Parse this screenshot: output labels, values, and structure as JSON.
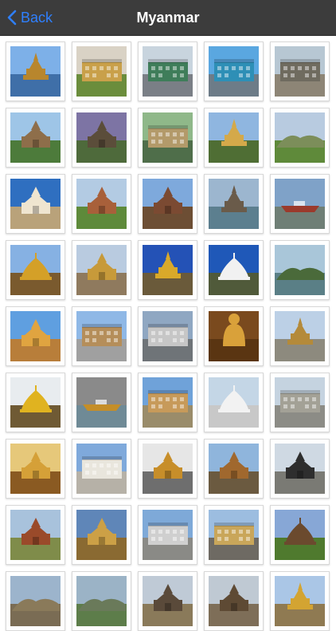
{
  "navbar": {
    "back_label": "Back",
    "title": "Myanmar"
  },
  "colors": {
    "navbar_bg": "#3c3c3c",
    "accent": "#2f80ff",
    "title_text": "#ffffff"
  },
  "gallery": {
    "tiles": [
      {
        "sky": "#7db0e8",
        "ground": "#3f6fa8",
        "subject": "#b8862d",
        "shape": "pagoda"
      },
      {
        "sky": "#d9d2c5",
        "ground": "#6b8d3c",
        "subject": "#c9a04a",
        "shape": "building"
      },
      {
        "sky": "#c8d4de",
        "ground": "#7a7f86",
        "subject": "#3f7d5a",
        "shape": "building"
      },
      {
        "sky": "#5aa7e0",
        "ground": "#6d7c88",
        "subject": "#2e8fb6",
        "shape": "building"
      },
      {
        "sky": "#b7c7d3",
        "ground": "#8d8576",
        "subject": "#6f6b5f",
        "shape": "building"
      },
      {
        "sky": "#9ec5e7",
        "ground": "#4d7b3b",
        "subject": "#8e6e4a",
        "shape": "temple"
      },
      {
        "sky": "#7d74a4",
        "ground": "#4e6a3b",
        "subject": "#5b4d3a",
        "shape": "temple"
      },
      {
        "sky": "#8fb889",
        "ground": "#4f6e4a",
        "subject": "#b39a6a",
        "shape": "building"
      },
      {
        "sky": "#8fb6e0",
        "ground": "#4f6e34",
        "subject": "#d4a94a",
        "shape": "pagoda"
      },
      {
        "sky": "#b8cbe0",
        "ground": "#5f8a3a",
        "subject": "#7c8e5a",
        "shape": "hill"
      },
      {
        "sky": "#2f6fc0",
        "ground": "#b9a27a",
        "subject": "#efe5d0",
        "shape": "temple"
      },
      {
        "sky": "#b3cbe3",
        "ground": "#5e8a3a",
        "subject": "#a8603a",
        "shape": "temple"
      },
      {
        "sky": "#7ea9dc",
        "ground": "#6d4e34",
        "subject": "#7b4a32",
        "shape": "temple"
      },
      {
        "sky": "#9cb6cf",
        "ground": "#5c7f8f",
        "subject": "#6a5b4a",
        "shape": "pagoda"
      },
      {
        "sky": "#7fa2c8",
        "ground": "#6f7f76",
        "subject": "#9b3a2c",
        "shape": "boat"
      },
      {
        "sky": "#86b1e3",
        "ground": "#7a5a2e",
        "subject": "#d4a028",
        "shape": "stupa"
      },
      {
        "sky": "#b9cbe0",
        "ground": "#8f7a5e",
        "subject": "#c79a3a",
        "shape": "temple"
      },
      {
        "sky": "#2452b6",
        "ground": "#6a5a3a",
        "subject": "#d9a92a",
        "shape": "pagoda"
      },
      {
        "sky": "#1f58b8",
        "ground": "#505a3a",
        "subject": "#f1f1f1",
        "shape": "stupa"
      },
      {
        "sky": "#a9c6d9",
        "ground": "#5a7f86",
        "subject": "#4a6a3a",
        "shape": "hill"
      },
      {
        "sky": "#5f9fe0",
        "ground": "#b87e3a",
        "subject": "#e0a440",
        "shape": "temple"
      },
      {
        "sky": "#8fb8e6",
        "ground": "#a0a0a0",
        "subject": "#b58e5a",
        "shape": "building"
      },
      {
        "sky": "#8fa7c2",
        "ground": "#6f7478",
        "subject": "#c6c6c6",
        "shape": "building"
      },
      {
        "sky": "#7a4a1e",
        "ground": "#5a3512",
        "subject": "#d9a13a",
        "shape": "buddha"
      },
      {
        "sky": "#bcd0e6",
        "ground": "#8d8a7e",
        "subject": "#b48a3a",
        "shape": "pagoda"
      },
      {
        "sky": "#e8ecef",
        "ground": "#6f5a34",
        "subject": "#e0b320",
        "shape": "stupa"
      },
      {
        "sky": "#8a8a8a",
        "ground": "#6f8a96",
        "subject": "#c58e28",
        "shape": "boat"
      },
      {
        "sky": "#6fa2d9",
        "ground": "#9a8c6a",
        "subject": "#c79a5a",
        "shape": "building"
      },
      {
        "sky": "#c4d6e6",
        "ground": "#c8c8c8",
        "subject": "#f2f2f2",
        "shape": "stupa"
      },
      {
        "sky": "#c5d3e0",
        "ground": "#8c8c86",
        "subject": "#a3a196",
        "shape": "building"
      },
      {
        "sky": "#e6c87a",
        "ground": "#8a5a22",
        "subject": "#d5a038",
        "shape": "temple"
      },
      {
        "sky": "#7fa9db",
        "ground": "#b6b1a7",
        "subject": "#e9e6dd",
        "shape": "building"
      },
      {
        "sky": "#e6e6e6",
        "ground": "#6e6e6e",
        "subject": "#c78e2a",
        "shape": "temple"
      },
      {
        "sky": "#8fb5dc",
        "ground": "#6b5a40",
        "subject": "#a0682e",
        "shape": "temple"
      },
      {
        "sky": "#cfd9e3",
        "ground": "#7a7a74",
        "subject": "#2e2e2e",
        "shape": "temple"
      },
      {
        "sky": "#a8c2dc",
        "ground": "#7f8c4a",
        "subject": "#9a4a2a",
        "shape": "temple"
      },
      {
        "sky": "#5f86b8",
        "ground": "#8a6a32",
        "subject": "#cca046",
        "shape": "temple"
      },
      {
        "sky": "#7ea9d8",
        "ground": "#8a8a86",
        "subject": "#cfcfcf",
        "shape": "building"
      },
      {
        "sky": "#9cbde0",
        "ground": "#6e6a63",
        "subject": "#c9a65a",
        "shape": "building"
      },
      {
        "sky": "#87a7d6",
        "ground": "#4f7a2e",
        "subject": "#6b4a2e",
        "shape": "stupa"
      },
      {
        "sky": "#9cb4cc",
        "ground": "#7a6c54",
        "subject": "#8a7a5a",
        "shape": "hill"
      },
      {
        "sky": "#9bb3c6",
        "ground": "#5d7d4a",
        "subject": "#6a7a5a",
        "shape": "hill"
      },
      {
        "sky": "#bfcad6",
        "ground": "#8a7a5a",
        "subject": "#5a4a3a",
        "shape": "temple"
      },
      {
        "sky": "#bfc9d3",
        "ground": "#7e6e58",
        "subject": "#5e4a34",
        "shape": "temple"
      },
      {
        "sky": "#aac6e6",
        "ground": "#8f7a52",
        "subject": "#d3a432",
        "shape": "pagoda"
      }
    ]
  }
}
